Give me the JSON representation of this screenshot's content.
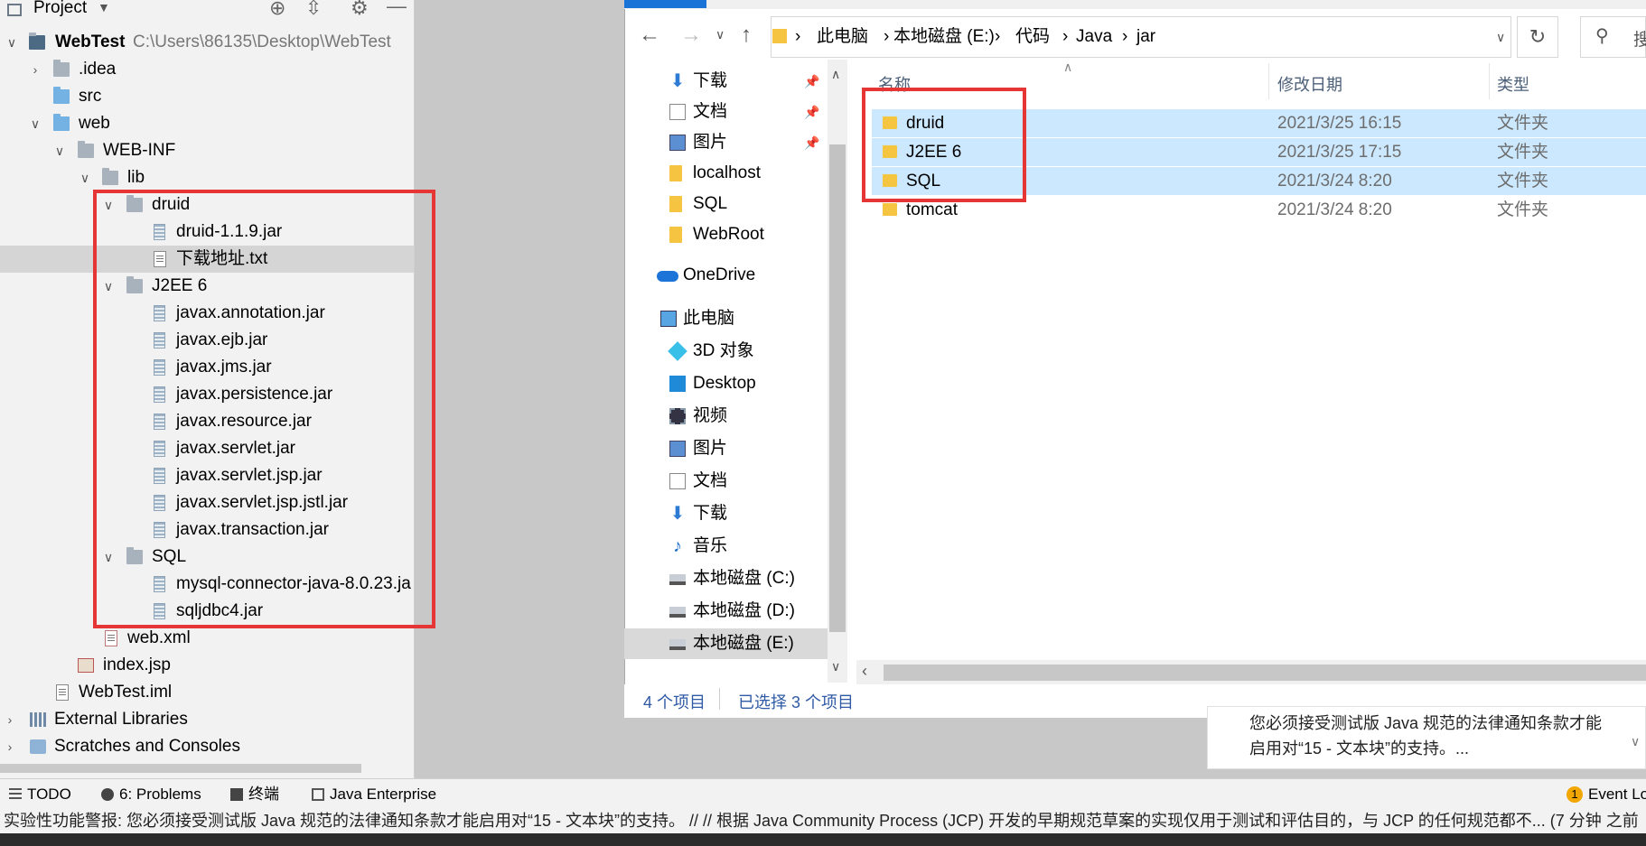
{
  "ide": {
    "panel_title": "Project",
    "project_name": "WebTest",
    "project_path": "C:\\Users\\86135\\Desktop\\WebTest",
    "tree": {
      "idea": ".idea",
      "src": "src",
      "web": "web",
      "webinf": "WEB-INF",
      "lib": "lib",
      "druid": "druid",
      "druid_jar": "druid-1.1.9.jar",
      "druid_txt": "下载地址.txt",
      "j2ee": "J2EE 6",
      "j2ee_jars": [
        "javax.annotation.jar",
        "javax.ejb.jar",
        "javax.jms.jar",
        "javax.persistence.jar",
        "javax.resource.jar",
        "javax.servlet.jar",
        "javax.servlet.jsp.jar",
        "javax.servlet.jsp.jstl.jar",
        "javax.transaction.jar"
      ],
      "sql": "SQL",
      "sql_jars": [
        "mysql-connector-java-8.0.23.ja",
        "sqljdbc4.jar"
      ],
      "webxml": "web.xml",
      "indexjsp": "index.jsp",
      "iml": "WebTest.iml",
      "ext_libs": "External Libraries",
      "scratches": "Scratches and Consoles"
    }
  },
  "explorer": {
    "breadcrumb": [
      "此电脑",
      "本地磁盘 (E:)",
      "代码",
      "Java",
      "jar"
    ],
    "search_placeholder": "搜",
    "nav": [
      {
        "label": "下载",
        "icon": "download-icon",
        "pinned": true
      },
      {
        "label": "文档",
        "icon": "document-icon",
        "pinned": true
      },
      {
        "label": "图片",
        "icon": "picture-icon",
        "pinned": true
      },
      {
        "label": "localhost",
        "icon": "folder-icon"
      },
      {
        "label": "SQL",
        "icon": "folder-icon"
      },
      {
        "label": "WebRoot",
        "icon": "folder-icon"
      },
      {
        "label": "OneDrive",
        "icon": "cloud-icon"
      },
      {
        "label": "此电脑",
        "icon": "computer-icon"
      },
      {
        "label": "3D 对象",
        "icon": "cube-icon"
      },
      {
        "label": "Desktop",
        "icon": "desktop-icon"
      },
      {
        "label": "视频",
        "icon": "video-icon"
      },
      {
        "label": "图片",
        "icon": "picture-icon"
      },
      {
        "label": "文档",
        "icon": "document-icon"
      },
      {
        "label": "下载",
        "icon": "download-icon"
      },
      {
        "label": "音乐",
        "icon": "music-icon"
      },
      {
        "label": "本地磁盘 (C:)",
        "icon": "drive-icon"
      },
      {
        "label": "本地磁盘 (D:)",
        "icon": "drive-icon"
      },
      {
        "label": "本地磁盘 (E:)",
        "icon": "drive-icon",
        "selected": true
      }
    ],
    "columns": {
      "name": "名称",
      "date": "修改日期",
      "type": "类型"
    },
    "files": [
      {
        "name": "druid",
        "date": "2021/3/25 16:15",
        "type": "文件夹",
        "selected": true
      },
      {
        "name": "J2EE 6",
        "date": "2021/3/25 17:15",
        "type": "文件夹",
        "selected": true
      },
      {
        "name": "SQL",
        "date": "2021/3/24 8:20",
        "type": "文件夹",
        "selected": true
      },
      {
        "name": "tomcat",
        "date": "2021/3/24 8:20",
        "type": "文件夹",
        "selected": false
      }
    ],
    "status_count": "4 个项目",
    "status_selected": "已选择 3 个项目"
  },
  "notification": {
    "line1": "您必须接受测试版 Java 规范的法律通知条款才能",
    "line2": "启用对“15 - 文本块”的支持。..."
  },
  "toolbar": {
    "todo": "TODO",
    "problems": "6: Problems",
    "terminal": "终端",
    "java_enterprise": "Java Enterprise",
    "event_log": "Event Lo",
    "event_count": "1"
  },
  "status": {
    "text": "实验性功能警报: 您必须接受测试版 Java 规范的法律通知条款才能启用对“15 - 文本块”的支持。 // // 根据 Java Community Process (JCP) 开发的早期规范草案的实现仅用于测试和评估目的，与 JCP 的任何规范都不... (7 分钟 之前"
  },
  "colors": {
    "highlight_box": "#e53535",
    "explorer_selection": "#cce8ff",
    "ide_selection": "#d5d5d5"
  }
}
